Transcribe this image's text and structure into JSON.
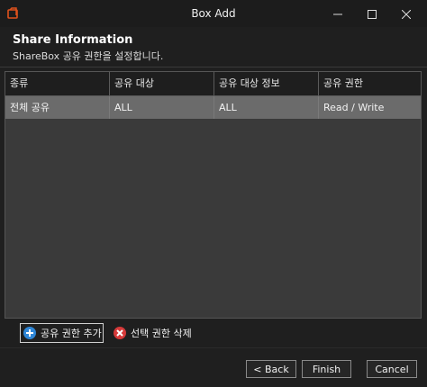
{
  "window": {
    "title": "Box Add"
  },
  "header": {
    "title": "Share Information",
    "subtitle": "ShareBox 공유 권한을 설정합니다."
  },
  "grid": {
    "columns": [
      "종류",
      "공유 대상",
      "공유 대상 정보",
      "공유 권한"
    ],
    "rows": [
      [
        "전체 공유",
        "ALL",
        "ALL",
        "Read / Write"
      ]
    ]
  },
  "toolbar": {
    "add_label": "공유 권한 추가",
    "delete_label": "선택 권한 삭제"
  },
  "footer": {
    "back_label": "< Back",
    "finish_label": "Finish",
    "cancel_label": "Cancel"
  },
  "colors": {
    "accent_blue": "#2f86d6",
    "delete_red": "#d63a3a",
    "app_icon": "#e0521d"
  }
}
